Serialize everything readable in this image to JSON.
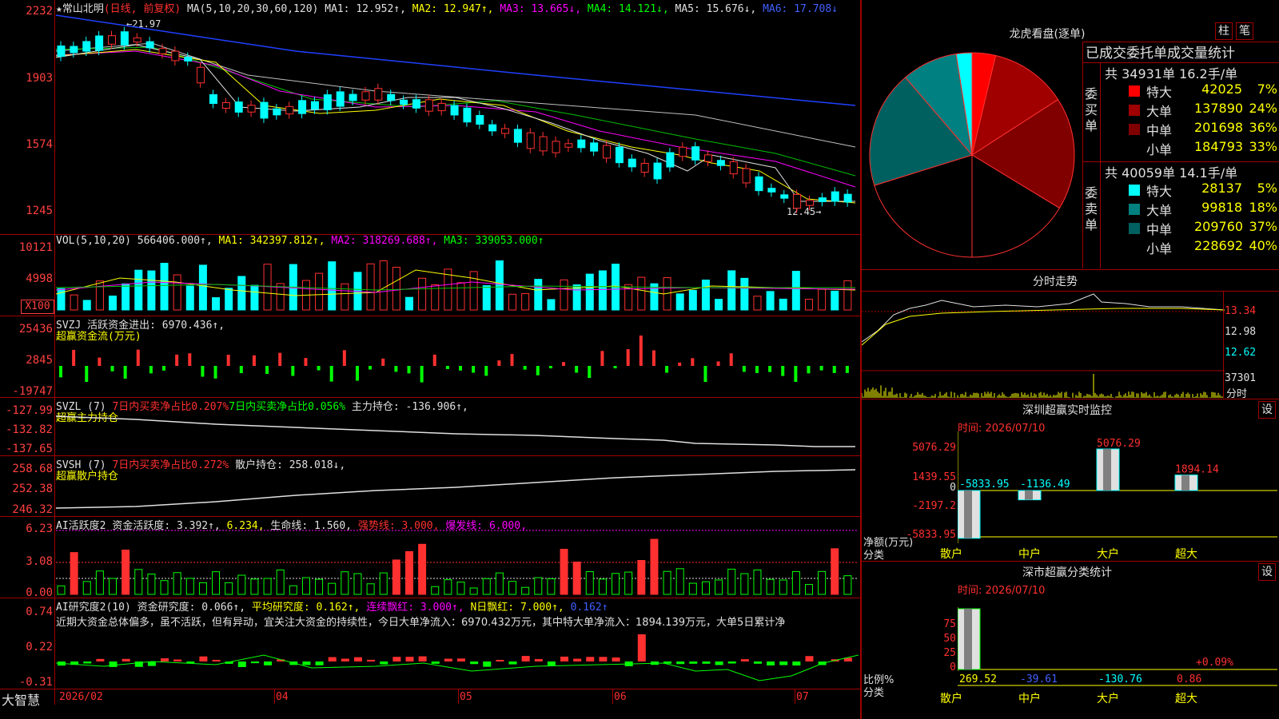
{
  "colors": {
    "up": "#ff3030",
    "down": "#00ffff",
    "border": "#a00000"
  },
  "kline": {
    "header": {
      "star": "★",
      "name": "常山北明",
      "mode": "(日线, 前复权)",
      "ma_title": "MA(5,10,20,30,60,120)",
      "ma1": "MA1: 12.952↑,",
      "ma2": "MA2: 12.947↑,",
      "ma3": "MA3: 13.665↓,",
      "ma4": "MA4: 14.121↓,",
      "ma5": "MA5: 15.676↓,",
      "ma6": "MA6: 17.708↓"
    },
    "y_labels": [
      "2232",
      "1903",
      "1574",
      "1245"
    ],
    "high_label": "←21.97",
    "low_label": "12.45→"
  },
  "vol": {
    "header": {
      "title": "VOL(5,10,20)",
      "value": "566406.000↑,",
      "ma1": "MA1: 342397.812↑,",
      "ma2": "MA2: 318269.688↑,",
      "ma3": "MA3: 339053.000↑"
    },
    "y_labels": [
      "10121",
      "4998"
    ],
    "unit": "X100"
  },
  "svzj": {
    "header": {
      "title": "SVZJ",
      "label": "活跃资金进出: 6970.436↑,",
      "sub": "超赢资金流(万元)"
    },
    "y_labels": [
      "25436",
      "2845",
      "-19747"
    ]
  },
  "svzl": {
    "header": {
      "title": "SVZL (7)",
      "r1": "7日内买卖净占比0.207%",
      "r2": "7日内买卖净占比0.056%",
      "r3": "主力持仓: -136.906↑,",
      "sub": "超赢主力持仓"
    },
    "y_labels": [
      "-127.99",
      "-132.82",
      "-137.65"
    ]
  },
  "svsh": {
    "header": {
      "title": "SVSH (7)",
      "r1": "7日内买卖净占比0.272%",
      "r2": "散户持仓: 258.018↓,",
      "sub": "超赢散户持仓"
    },
    "y_labels": [
      "258.68",
      "252.38",
      "246.32"
    ]
  },
  "ai_act": {
    "header": {
      "title": "AI活跃度2",
      "a": "资金活跃度: 3.392↑,",
      "b": "6.234,",
      "c": "生命线: 1.560,",
      "d": "强势线: 3.000,",
      "e": "爆发线: 6.000,"
    },
    "y_labels": [
      "6.23",
      "3.08",
      "0.00"
    ]
  },
  "ai_res": {
    "header": {
      "title": "AI研究度2(10)",
      "a": "资金研究度: 0.066↑,",
      "b": "平均研究度: 0.162↑,",
      "c": "连续飘红: 3.000↑,",
      "d": "N日飘红: 7.000↑,",
      "e": "0.162↑"
    },
    "text": "近期大资金总体偏多，虽不活跃，但有异动，宜关注大资金的持续性，今日大单净流入：6970.432万元，其中特大单净流入：1894.139万元，大单5日累计净",
    "y_labels": [
      "0.74",
      "0.22",
      "-0.31"
    ]
  },
  "x_axis": {
    "brand": "大智慧",
    "labels": [
      "2026/02",
      "04",
      "05",
      "06",
      "07"
    ]
  },
  "dragon": {
    "title": "龙虎看盘(逐单)",
    "btn_bar": "柱",
    "btn_order": "笔",
    "stats_title": "已成交委托单成交量统计",
    "buy_side": "委买单",
    "sell_side": "委卖单",
    "buy_total": "共 34931单 16.2手/单",
    "sell_total": "共 40059单 14.1手/单",
    "buy_rows": [
      {
        "label": "特大",
        "value": "42025",
        "pct": "7%",
        "color": "#ff0000"
      },
      {
        "label": "大单",
        "value": "137890",
        "pct": "24%",
        "color": "#a00000"
      },
      {
        "label": "中单",
        "value": "201698",
        "pct": "36%",
        "color": "#800000"
      },
      {
        "label": "小单",
        "value": "184793",
        "pct": "33%",
        "color": "#000000"
      }
    ],
    "sell_rows": [
      {
        "label": "特大",
        "value": "28137",
        "pct": "5%",
        "color": "#00ffff"
      },
      {
        "label": "大单",
        "value": "99818",
        "pct": "18%",
        "color": "#008080"
      },
      {
        "label": "中单",
        "value": "209760",
        "pct": "37%",
        "color": "#006060"
      },
      {
        "label": "小单",
        "value": "228692",
        "pct": "40%",
        "color": "#000000"
      }
    ]
  },
  "intraday": {
    "title": "分时走势",
    "y_labels": [
      "13.34",
      "12.98",
      "12.62"
    ],
    "vol_label": "37301",
    "time_label": "分时"
  },
  "realtime": {
    "title": "深圳超赢实时监控",
    "btn": "设",
    "time": "时间: 2026/07/10",
    "y_labels": [
      "5076.29",
      "1439.55",
      "0",
      "-2197.2",
      "-5833.95"
    ],
    "axis_title": "净额(万元)",
    "axis_sub": "分类",
    "categories": [
      "散户",
      "中户",
      "大户",
      "超大"
    ],
    "values": [
      -5833.95,
      -1136.49,
      5076.29,
      1894.14
    ],
    "value_labels": [
      "-5833.95",
      "-1136.49",
      "5076.29",
      "1894.14"
    ]
  },
  "classify": {
    "title": "深市超赢分类统计",
    "btn": "设",
    "time": "时间: 2026/07/10",
    "y_labels": [
      "75",
      "50",
      "25",
      "0"
    ],
    "axis_title": "比例%",
    "axis_sub": "分类",
    "categories": [
      "散户",
      "中户",
      "大户",
      "超大"
    ],
    "values": [
      269.52,
      -39.61,
      -130.76,
      0.86
    ],
    "value_labels": [
      "269.52",
      "-39.61",
      "-130.76",
      "0.86"
    ],
    "note": "+0.09%"
  }
}
